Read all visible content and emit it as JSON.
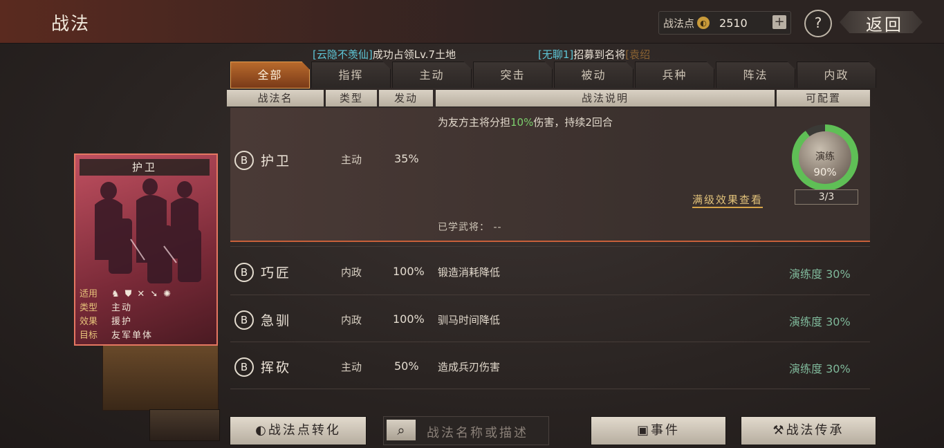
{
  "header": {
    "title": "战法",
    "points_label": "战法点",
    "points_value": "2510",
    "plus": "+",
    "help": "?",
    "back": "返回"
  },
  "ticker": [
    {
      "highlight": "[云隐不羡仙]",
      "text": "成功占领Lv.7土地",
      "extra": ""
    },
    {
      "highlight": "[无聊1]",
      "text": "招募到名将",
      "extra": "[袁绍"
    }
  ],
  "tabs": [
    "全部",
    "指挥",
    "主动",
    "突击",
    "被动",
    "兵种",
    "阵法",
    "内政"
  ],
  "columns": {
    "name": "战法名",
    "type": "类型",
    "trigger": "发动",
    "desc": "战法说明",
    "config": "可配置"
  },
  "selected": {
    "grade": "B",
    "name": "护卫",
    "type": "主动",
    "rate": "35%",
    "desc_pre": "为友方主将分担",
    "desc_hl": "10%",
    "desc_post": "伤害，持续2回合",
    "full_effect": "满级效果查看",
    "learned": "已学武将：  --",
    "practice_label": "演练",
    "practice_value": "90%",
    "practice_progress": 0.9,
    "count": "3/3"
  },
  "rows": [
    {
      "grade": "B",
      "name": "巧匠",
      "type": "内政",
      "rate": "100%",
      "desc": "锻造消耗降低",
      "prof": "演练度 30%"
    },
    {
      "grade": "B",
      "name": "急驯",
      "type": "内政",
      "rate": "100%",
      "desc": "驯马时间降低",
      "prof": "演练度 30%"
    },
    {
      "grade": "B",
      "name": "挥砍",
      "type": "主动",
      "rate": "50%",
      "desc": "造成兵刃伤害",
      "prof": "演练度 30%"
    }
  ],
  "card": {
    "title": "护卫",
    "labels": {
      "troops": "适用",
      "type": "类型",
      "effect": "效果",
      "target": "目标"
    },
    "type": "主动",
    "effect": "援护",
    "target": "友军单体",
    "troop_icons": [
      "cavalry-icon",
      "shield-icon",
      "bow-icon",
      "spear-icon",
      "wheel-icon"
    ]
  },
  "buttons": {
    "convert": "战法点转化",
    "search_placeholder": "战法名称或描述",
    "event": "事件",
    "inherit": "战法传承"
  },
  "colors": {
    "accent": "#c8603a",
    "highlight_cyan": "#5ec7d8",
    "green": "#7ccf6c",
    "gold": "#e2c27a"
  }
}
